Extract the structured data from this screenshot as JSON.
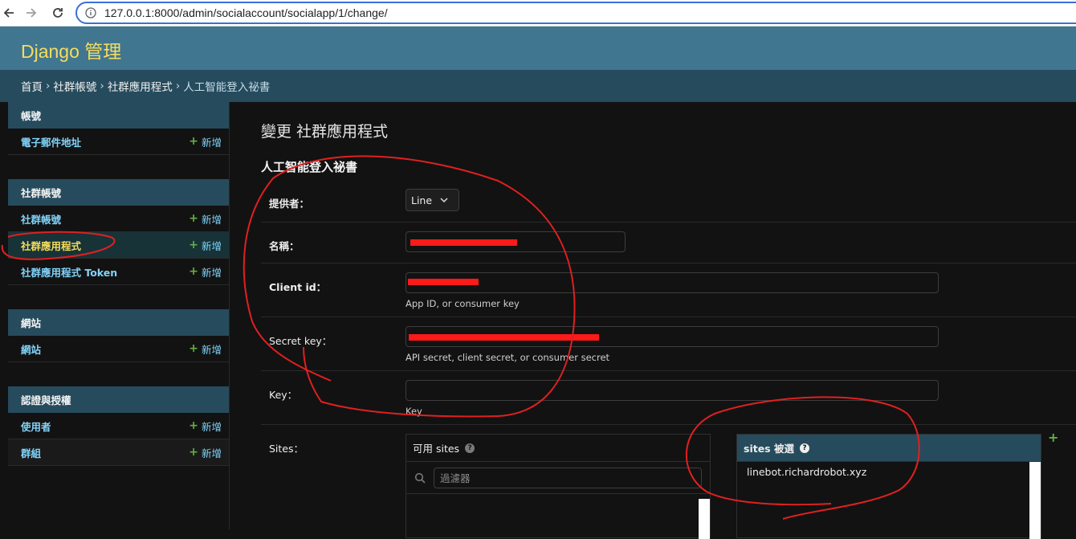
{
  "browser": {
    "url": "127.0.0.1:8000/admin/socialaccount/socialapp/1/change/"
  },
  "header": {
    "branding": "Django 管理"
  },
  "breadcrumbs": [
    "首頁",
    "社群帳號",
    "社群應用程式",
    "人工智能登入祕書"
  ],
  "breadcrumb_sep": "›",
  "sidebar": {
    "add_label": "新增",
    "modules": [
      {
        "caption": "帳號",
        "models": [
          {
            "name": "電子郵件地址"
          }
        ]
      },
      {
        "caption": "社群帳號",
        "models": [
          {
            "name": "社群帳號"
          },
          {
            "name": "社群應用程式",
            "current": true
          },
          {
            "name": "社群應用程式 Token"
          }
        ]
      },
      {
        "caption": "網站",
        "models": [
          {
            "name": "網站"
          }
        ]
      },
      {
        "caption": "認證與授權",
        "models": [
          {
            "name": "使用者"
          },
          {
            "name": "群組"
          }
        ]
      }
    ]
  },
  "main": {
    "title": "變更 社群應用程式",
    "object_name": "人工智能登入祕書",
    "fields": {
      "provider": {
        "label": "提供者：",
        "value": "Line"
      },
      "name": {
        "label": "名稱："
      },
      "client_id": {
        "label": "Client id：",
        "help": "App ID, or consumer key"
      },
      "secret": {
        "label": "Secret key：",
        "help": "API secret, client secret, or consumer secret"
      },
      "key": {
        "label": "Key：",
        "help": "Key",
        "value": ""
      },
      "sites": {
        "label": "Sites：",
        "available_title": "可用 sites",
        "filter_placeholder": "過濾器",
        "chosen_title": "sites 被選",
        "chosen": [
          "linebot.richardrobot.xyz"
        ],
        "add_symbol": "+"
      }
    }
  },
  "colors": {
    "header": "#417690",
    "breadcrumbs": "#264b5d",
    "branding": "#f5dd5d",
    "link": "#81d4fa",
    "add": "#5fb340",
    "annotation": "#e02020"
  }
}
